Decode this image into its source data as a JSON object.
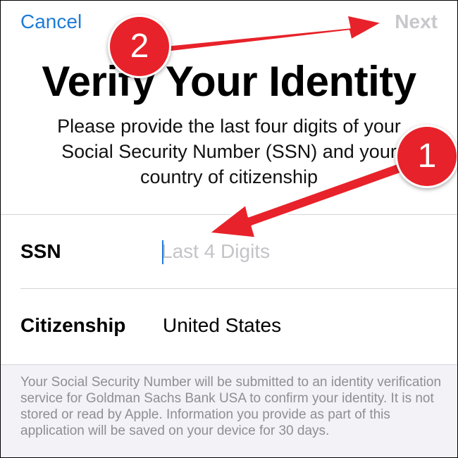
{
  "nav": {
    "cancel_label": "Cancel",
    "next_label": "Next"
  },
  "header": {
    "title": "Verify Your Identity",
    "subtitle": "Please provide the last four digits of your Social Security Number (SSN) and your country of citizenship"
  },
  "form": {
    "ssn": {
      "label": "SSN",
      "value": "",
      "placeholder": "Last 4 Digits"
    },
    "citizenship": {
      "label": "Citizenship",
      "value": "United States"
    }
  },
  "footer": {
    "disclaimer": "Your Social Security Number will be submitted to an identity verification service for Goldman Sachs Bank USA to confirm your identity. It is not stored or read by Apple. Information you provide as part of this application will be saved on your device for 30 days."
  },
  "annotations": {
    "badge_1": "1",
    "badge_2": "2",
    "color": "#e8222a"
  },
  "colors": {
    "accent": "#1e7bd8",
    "disabled": "#c8c8cc",
    "background": "#f2f2f7"
  }
}
